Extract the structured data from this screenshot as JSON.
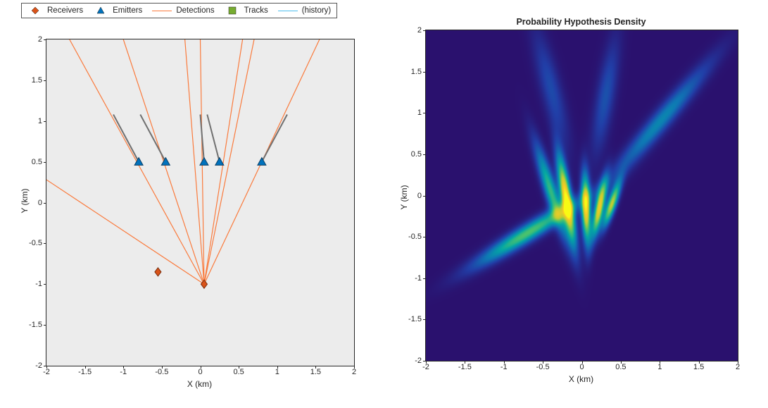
{
  "legend": {
    "items": [
      {
        "label": "Receivers",
        "marker": "diamond",
        "color": "#d95319"
      },
      {
        "label": "Emitters",
        "marker": "triangle",
        "color": "#0072bd"
      },
      {
        "label": "Detections",
        "marker": "line",
        "color": "#fa7a3c"
      },
      {
        "label": "Tracks",
        "marker": "square",
        "color": "#77ac30"
      },
      {
        "label": "(history)",
        "marker": "line",
        "color": "#4dbeee"
      }
    ]
  },
  "left": {
    "xlabel": "X (km)",
    "ylabel": "Y (km)",
    "xticks": [
      -2,
      -1.5,
      -1,
      -0.5,
      0,
      0.5,
      1,
      1.5,
      2
    ],
    "yticks": [
      -2,
      -1.5,
      -1,
      -0.5,
      0,
      0.5,
      1,
      1.5,
      2
    ]
  },
  "right": {
    "title": "Probability Hypothesis Density",
    "xlabel": "X (km)",
    "ylabel": "Y (km)",
    "xticks": [
      -2,
      -1.5,
      -1,
      -0.5,
      0,
      0.5,
      1,
      1.5,
      2
    ],
    "yticks": [
      -2,
      -1.5,
      -1,
      -0.5,
      0,
      0.5,
      1,
      1.5,
      2
    ]
  },
  "chart_data": [
    {
      "panel": "left",
      "xlabel": "X (km)",
      "ylabel": "Y (km)",
      "xlim": [
        -2,
        2
      ],
      "ylim": [
        -2,
        2
      ],
      "series": [
        {
          "name": "Receivers",
          "type": "scatter",
          "marker": "diamond",
          "color": "#d95319",
          "points": [
            [
              -0.55,
              -0.85
            ],
            [
              0.05,
              -1.0
            ]
          ]
        },
        {
          "name": "Emitters",
          "type": "scatter",
          "marker": "triangle",
          "color": "#0072bd",
          "points": [
            [
              -0.8,
              0.5
            ],
            [
              -0.45,
              0.5
            ],
            [
              0.05,
              0.5
            ],
            [
              0.25,
              0.5
            ],
            [
              0.8,
              0.5
            ]
          ]
        },
        {
          "name": "EmitterTrails",
          "type": "lines",
          "color": "#707070",
          "width": 2,
          "segments": [
            [
              [
                -1.13,
                1.08
              ],
              [
                -0.8,
                0.5
              ]
            ],
            [
              [
                -0.78,
                1.08
              ],
              [
                -0.45,
                0.5
              ]
            ],
            [
              [
                0.0,
                1.08
              ],
              [
                0.05,
                0.5
              ]
            ],
            [
              [
                0.09,
                1.08
              ],
              [
                0.25,
                0.5
              ]
            ],
            [
              [
                1.13,
                1.08
              ],
              [
                0.8,
                0.5
              ]
            ]
          ]
        },
        {
          "name": "Detections",
          "type": "lines",
          "color": "#fa7a3c",
          "width": 1.2,
          "segments": [
            [
              [
                0.05,
                -1.0
              ],
              [
                -1.7,
                2.0
              ]
            ],
            [
              [
                0.05,
                -1.0
              ],
              [
                -1.0,
                2.0
              ]
            ],
            [
              [
                0.05,
                -1.0
              ],
              [
                -0.2,
                2.0
              ]
            ],
            [
              [
                0.05,
                -1.0
              ],
              [
                0.0,
                2.0
              ]
            ],
            [
              [
                0.05,
                -1.0
              ],
              [
                0.55,
                2.0
              ]
            ],
            [
              [
                0.05,
                -1.0
              ],
              [
                0.7,
                2.0
              ]
            ],
            [
              [
                0.05,
                -1.0
              ],
              [
                1.55,
                2.0
              ]
            ],
            [
              [
                0.05,
                -1.0
              ],
              [
                -2.0,
                0.28
              ]
            ]
          ]
        }
      ]
    },
    {
      "panel": "right",
      "type": "heatmap",
      "title": "Probability Hypothesis Density",
      "xlabel": "X (km)",
      "ylabel": "Y (km)",
      "xlim": [
        -2,
        2
      ],
      "ylim": [
        -2,
        2
      ],
      "colormap": "parula",
      "note": "intensity streaks along detection bearings, peaks near emitter positions and ghost lobes",
      "peaks": [
        {
          "x": -0.2,
          "y": -0.05,
          "width": 0.12,
          "len": 0.9,
          "angle": 100,
          "intensity": 1.0
        },
        {
          "x": 0.05,
          "y": -0.15,
          "width": 0.1,
          "len": 0.7,
          "angle": 92,
          "intensity": 0.9
        },
        {
          "x": 0.22,
          "y": -0.15,
          "width": 0.1,
          "len": 0.6,
          "angle": 78,
          "intensity": 0.85
        },
        {
          "x": 0.38,
          "y": -0.1,
          "width": 0.1,
          "len": 0.5,
          "angle": 70,
          "intensity": 0.75
        },
        {
          "x": -0.4,
          "y": 0.05,
          "width": 0.14,
          "len": 1.0,
          "angle": 108,
          "intensity": 0.55
        },
        {
          "x": -0.7,
          "y": -0.45,
          "width": 0.18,
          "len": 1.3,
          "angle": 210,
          "intensity": 0.6
        },
        {
          "x": 1.0,
          "y": 0.9,
          "width": 0.2,
          "len": 1.6,
          "angle": 48,
          "intensity": 0.35
        },
        {
          "x": 0.3,
          "y": 1.2,
          "width": 0.2,
          "len": 1.2,
          "angle": 80,
          "intensity": 0.2
        },
        {
          "x": -0.4,
          "y": 1.3,
          "width": 0.22,
          "len": 1.2,
          "angle": 105,
          "intensity": 0.18
        }
      ]
    }
  ]
}
